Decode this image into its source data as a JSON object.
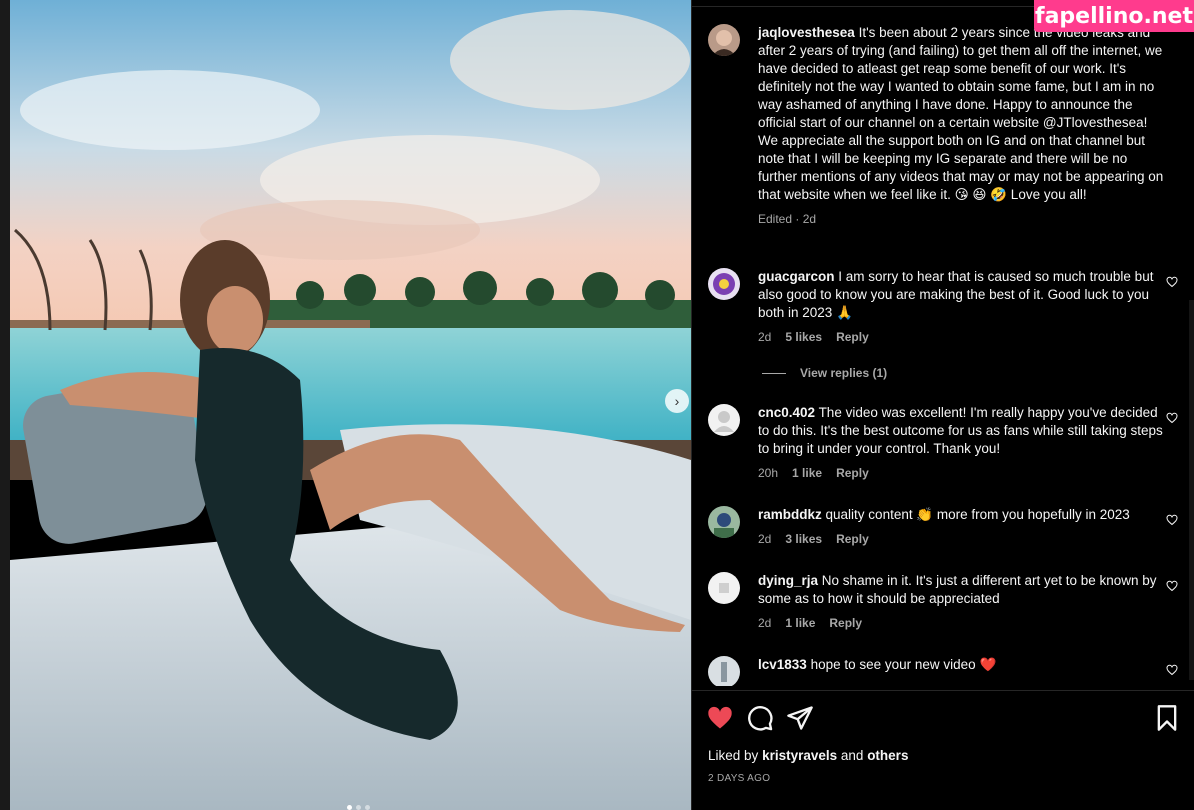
{
  "watermark": "fapellino.net",
  "caption": {
    "username": "jaqlovesthesea",
    "text": "It's been about 2 years since the video leaks and after 2 years of trying (and failing) to get them all off the internet, we have decided to atleast get reap some benefit of our work. It's definitely not the way I wanted to obtain some fame, but I am in no way ashamed of anything I have done. Happy to announce the official start of our channel on a certain website @JTlovesthesea! We appreciate all the support both on IG and on that channel but note that I will be keeping my IG separate and there will be no further mentions of any videos that may or may not be appearing on that website when we feel like it. 😘 😆 🤣 Love you all!",
    "meta": "Edited · 2d"
  },
  "comments": [
    {
      "username": "guacgarcon",
      "text": "I am sorry to hear that is caused so much trouble but also good to know you are making the best of it. Good luck to you both in 2023 🙏",
      "time": "2d",
      "likes": "5 likes",
      "reply": "Reply"
    },
    {
      "username": "cnc0.402",
      "text": "The video was excellent! I'm really happy you've decided to do this. It's the best outcome for us as fans while still taking steps to bring it under your control. Thank you!",
      "time": "20h",
      "likes": "1 like",
      "reply": "Reply"
    },
    {
      "username": "rambddkz",
      "text": "quality content 👏 more from you hopefully in 2023",
      "time": "2d",
      "likes": "3 likes",
      "reply": "Reply"
    },
    {
      "username": "dying_rja",
      "text": "No shame in it. It's just a different art yet to be known by some as to how it should be appreciated",
      "time": "2d",
      "likes": "1 like",
      "reply": "Reply"
    },
    {
      "username": "lcv1833",
      "text": "hope to see your new video ❤️"
    }
  ],
  "view_replies": "View replies (1)",
  "liked_by": {
    "prefix": "Liked by",
    "user": "kristyravels",
    "and": "and",
    "others": "others"
  },
  "date": "2 DAYS AGO",
  "colors": {
    "like_red": "#ed4956",
    "text": "#f5f5f5",
    "muted": "#a8a8a8",
    "bg": "#000000",
    "watermark": "#ff3b8d"
  },
  "icons": [
    "heart-icon",
    "comment-icon",
    "share-icon",
    "bookmark-icon",
    "chevron-right-icon"
  ]
}
